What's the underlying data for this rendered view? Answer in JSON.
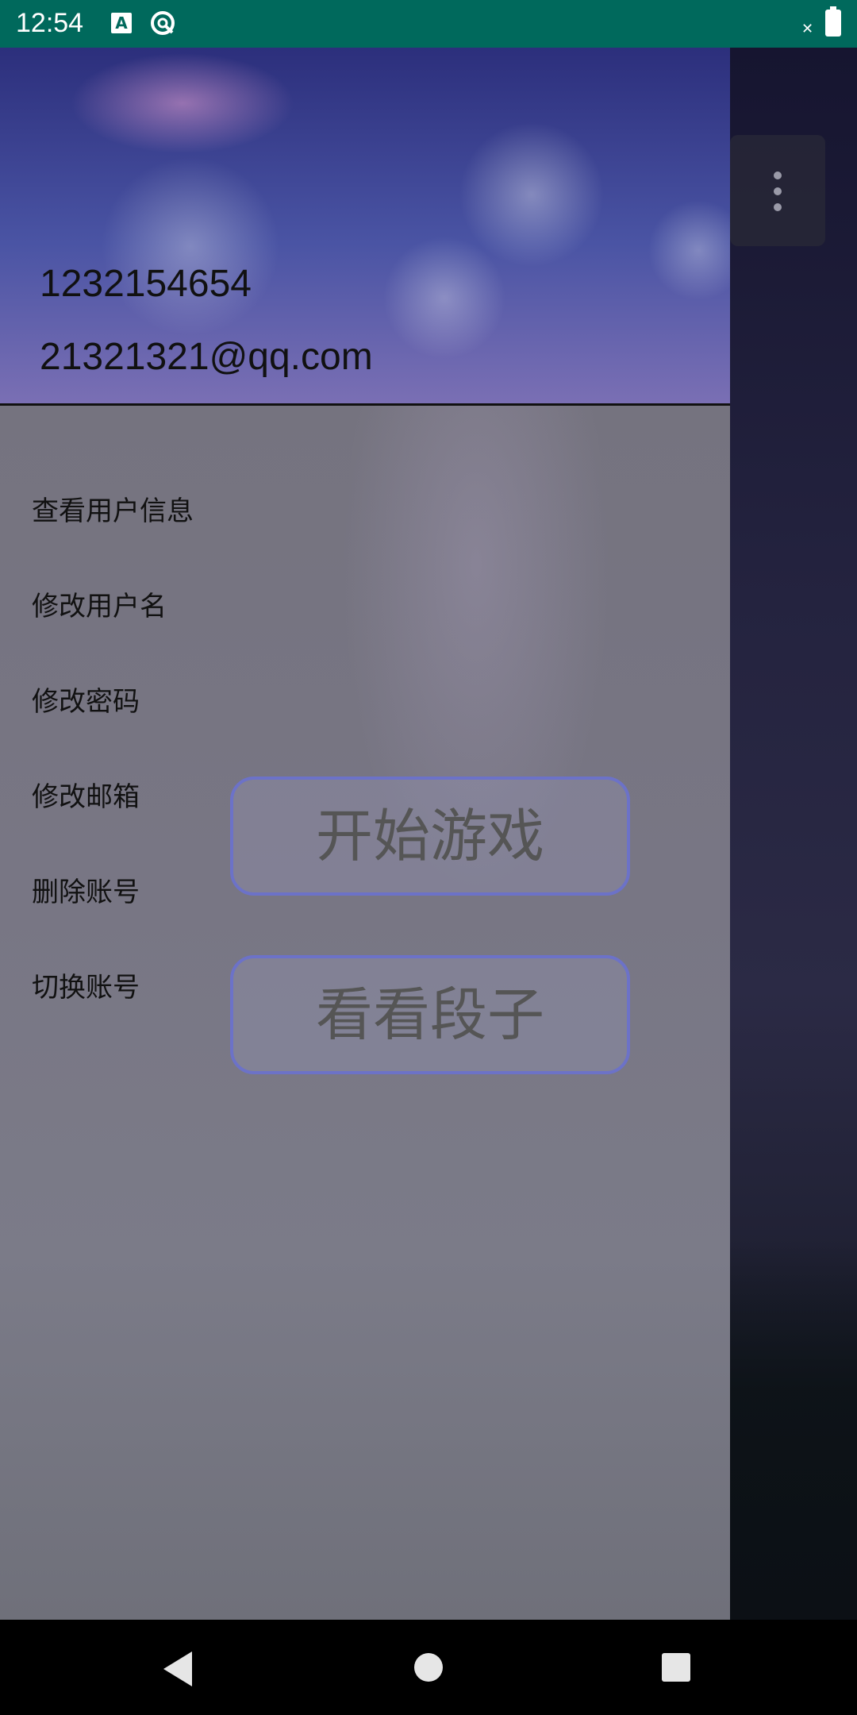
{
  "status_bar": {
    "time": "12:54",
    "notification_icon_letter": "A"
  },
  "header": {
    "phone": "1232154654",
    "email": "21321321@qq.com"
  },
  "drawer_menu": {
    "items": [
      {
        "label": "查看用户信息"
      },
      {
        "label": "修改用户名"
      },
      {
        "label": "修改密码"
      },
      {
        "label": "修改邮箱"
      },
      {
        "label": "删除账号"
      },
      {
        "label": "切换账号"
      }
    ]
  },
  "main": {
    "start_game_label": "开始游戏",
    "jokes_label": "看看段子"
  },
  "icons": {
    "overflow": "more-vert-icon",
    "back": "back-icon",
    "home": "home-icon",
    "recent": "recent-apps-icon"
  },
  "colors": {
    "status_bar": "#00695c",
    "button_border": "#6c72c8"
  }
}
